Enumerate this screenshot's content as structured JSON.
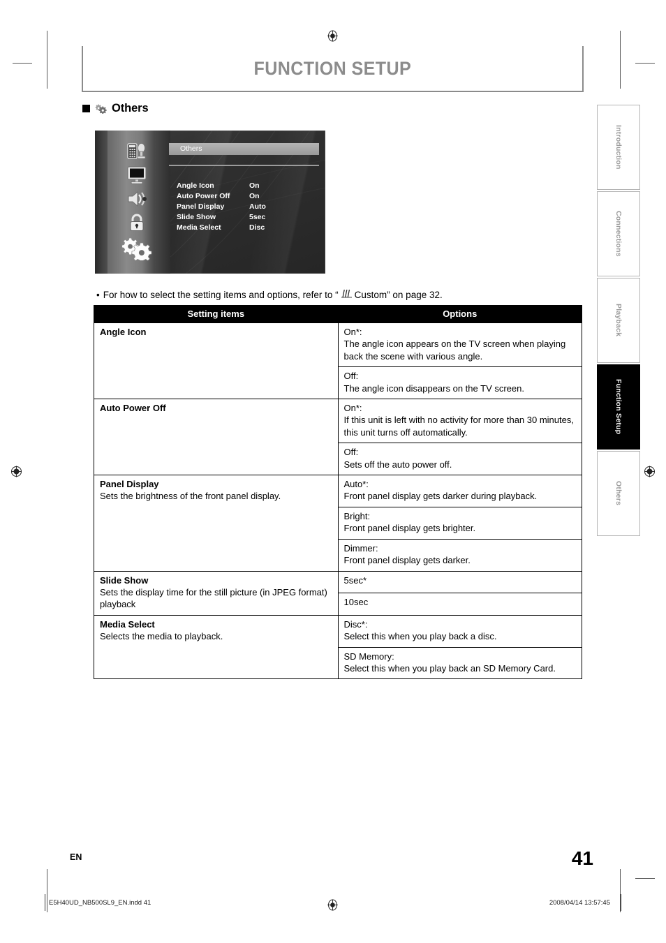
{
  "header": {
    "title": "FUNCTION SETUP"
  },
  "section": {
    "icon": "gears-icon",
    "label": "Others"
  },
  "osd": {
    "panel_title": "Others",
    "sidebar_icons": [
      "remote-control-icon",
      "tv-monitor-icon",
      "audio-speaker-icon",
      "lock-icon",
      "gears-icon"
    ],
    "rows": [
      {
        "name": "Angle Icon",
        "value": "On"
      },
      {
        "name": "Auto Power Off",
        "value": "On"
      },
      {
        "name": "Panel Display",
        "value": "Auto"
      },
      {
        "name": "Slide Show",
        "value": "5sec"
      },
      {
        "name": "Media Select",
        "value": "Disc"
      }
    ]
  },
  "note": {
    "bullet": "•",
    "text_before": "For how to select the setting items and options, refer to “",
    "icon": "custom-sliders-icon",
    "text_after": "Custom” on page 32."
  },
  "table": {
    "columns": [
      "Setting items",
      "Options"
    ],
    "rows": [
      {
        "name": "Angle Icon",
        "desc": "",
        "options": [
          {
            "title": "On*:",
            "body": "The angle icon appears on the TV screen when playing back the scene with various angle."
          },
          {
            "title": "Off:",
            "body": "The angle icon disappears on the TV screen."
          }
        ]
      },
      {
        "name": "Auto Power Off",
        "desc": "",
        "options": [
          {
            "title": "On*:",
            "body": "If this unit is left with no activity for more than 30 minutes, this unit turns off automatically."
          },
          {
            "title": "Off:",
            "body": "Sets off the auto power off."
          }
        ]
      },
      {
        "name": "Panel Display",
        "desc": "Sets the brightness of the front panel display.",
        "options": [
          {
            "title": "Auto*:",
            "body": "Front panel display gets darker during playback."
          },
          {
            "title": "Bright:",
            "body": "Front panel display gets brighter."
          },
          {
            "title": "Dimmer:",
            "body": "Front panel display gets darker."
          }
        ]
      },
      {
        "name": "Slide Show",
        "desc": "Sets the display time for the still picture (in JPEG format) playback",
        "options": [
          {
            "title": "5sec*",
            "body": ""
          },
          {
            "title": "10sec",
            "body": ""
          }
        ]
      },
      {
        "name": "Media Select",
        "desc": "Selects the media to playback.",
        "options": [
          {
            "title": "Disc*:",
            "body": "Select this when you play back a disc."
          },
          {
            "title": "SD Memory:",
            "body": "Select this when you play back an SD Memory Card."
          }
        ]
      }
    ]
  },
  "side_tabs": [
    {
      "label": "Introduction",
      "active": false
    },
    {
      "label": "Connections",
      "active": false
    },
    {
      "label": "Playback",
      "active": false
    },
    {
      "label": "Function Setup",
      "active": true
    },
    {
      "label": "Others",
      "active": false
    }
  ],
  "footer": {
    "language": "EN",
    "page_number": "41",
    "file_name": "E5H40UD_NB500SL9_EN.indd   41",
    "timestamp": "2008/04/14   13:57:45"
  },
  "colors": {
    "header_text": "#8c8c8c",
    "header_border": "#8b8b8b",
    "table_header_bg": "#000000",
    "tab_inactive_text": "#9a9a9a",
    "tab_active_bg": "#000000"
  }
}
